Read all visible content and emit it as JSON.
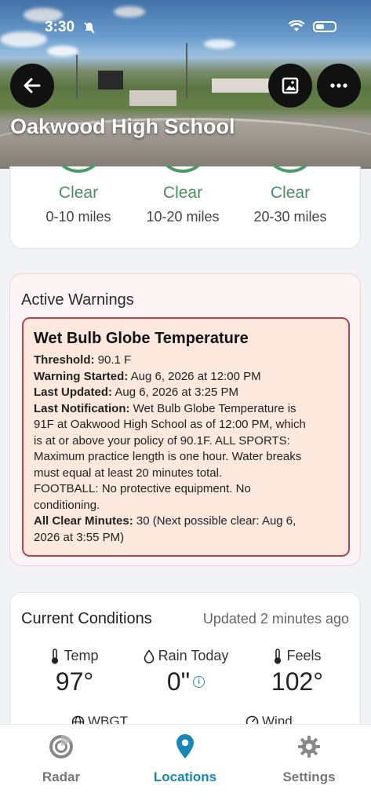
{
  "status_bar": {
    "time": "3:30"
  },
  "header": {
    "title": "Oakwood High School"
  },
  "lightning": {
    "ranges": [
      {
        "status": "Clear",
        "distance": "0-10 miles"
      },
      {
        "status": "Clear",
        "distance": "10-20 miles"
      },
      {
        "status": "Clear",
        "distance": "20-30 miles"
      }
    ],
    "status_color": "#4a8f64"
  },
  "warnings": {
    "heading": "Active Warnings",
    "items": [
      {
        "title": "Wet Bulb Globe Temperature",
        "threshold_label": "Threshold:",
        "threshold": "90.1 F",
        "started_label": "Warning Started:",
        "started": "Aug 6, 2026 at 12:00 PM",
        "updated_label": "Last Updated:",
        "updated": "Aug 6, 2026 at 3:25 PM",
        "notification_label": "Last Notification:",
        "notification_1": "Wet Bulb Globe Temperature is",
        "notification_2": "91F at Oakwood High School  as of 12:00 PM, which",
        "notification_3": "is at or above your policy of 90.1F. ALL SPORTS:",
        "notification_4": "Maximum practice length is one hour. Water breaks",
        "notification_5": "must equal at least 20 minutes total.",
        "notification_6": "FOOTBALL: No protective equipment. No",
        "notification_7": "conditioning.",
        "all_clear_label": "All Clear Minutes:",
        "all_clear": "30 (Next possible clear: Aug 6,",
        "all_clear_2": "2026 at 3:55 PM)"
      }
    ],
    "border_color": "#b5454d"
  },
  "conditions": {
    "heading": "Current Conditions",
    "updated": "Updated 2 minutes ago",
    "temp_label": "Temp",
    "temp_value": "97°",
    "rain_label": "Rain Today",
    "rain_value": "0\"",
    "feels_label": "Feels",
    "feels_value": "102°",
    "wbgt_label": "WBGT",
    "wind_label": "Wind"
  },
  "tabs": [
    {
      "label": "Radar",
      "icon": "radar-icon",
      "active": false
    },
    {
      "label": "Locations",
      "icon": "location-pin-icon",
      "active": true
    },
    {
      "label": "Settings",
      "icon": "gear-icon",
      "active": false
    }
  ],
  "accent_color": "#1787b5"
}
